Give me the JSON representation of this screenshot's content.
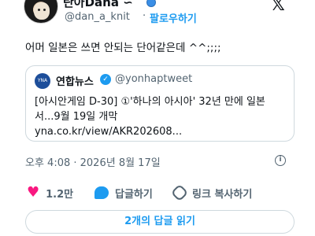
{
  "author": {
    "display_name": "란아Dana ∽",
    "handle": "@dan_a_knit",
    "separator": "·",
    "follow_label": "팔로우하기"
  },
  "tweet": {
    "text": "어머 일본은 쓰면 안되는 단어같은데 ^^;;;;"
  },
  "quote": {
    "name": "연합뉴스",
    "handle": "@yonhaptweet",
    "lines": [
      "[아시안게임 D-30] ①'하나의 아시아' 32년 만에 일본",
      "서...9월 19일 개막",
      "yna.co.kr/view/AKR202608..."
    ]
  },
  "meta": {
    "timestamp": "오후 4:08 · 2026년 8월 17일"
  },
  "actions": {
    "likes": "1.2만",
    "reply": "답글하기",
    "copy_link": "링크 복사하기"
  },
  "replies_button": "2개의 답글 읽기",
  "colors": {
    "accent": "#1d9bf0",
    "like": "#f91880",
    "muted": "#536471"
  }
}
